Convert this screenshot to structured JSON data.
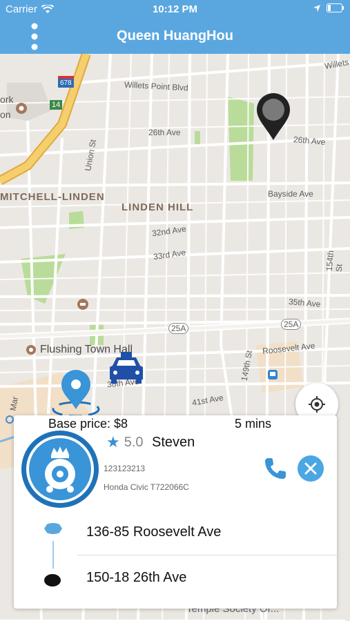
{
  "status": {
    "carrier": "Carrier",
    "time": "10:12 PM"
  },
  "nav": {
    "title": "Queen HuangHou"
  },
  "map": {
    "labels": {
      "willets_point": "Willets Point Blvd",
      "willets": "Willets",
      "ave26_left": "26th Ave",
      "ave26_right": "26th Ave",
      "union_st": "Union St",
      "mitchell_linden": "MITCHELL-LINDEN",
      "linden_hill": "LINDEN HILL",
      "bayside": "Bayside Ave",
      "ave32": "32nd Ave",
      "ave33": "33rd Ave",
      "st154": "154th St",
      "ave35": "35th Ave",
      "rt25a_left": "25A",
      "rt25a_right": "25A",
      "flushing_town_hall": "Flushing Town Hall",
      "roosevelt": "Roosevelt Ave",
      "st149": "149th St",
      "ave38": "38th Ave",
      "ave41": "41st Ave",
      "york_frag": "ork",
      "on_frag": "on",
      "i678": "678",
      "rt14": "14",
      "temple": "Temple Society Of...",
      "mar_frag": "Mar"
    }
  },
  "card": {
    "base_price": "Base price: $8",
    "eta": "5 mins",
    "rating": "5.0",
    "driver_name": "Steven",
    "phone": "123123213",
    "car": "Honda Civic T722066C",
    "pickup": "136-85 Roosevelt Ave",
    "dropoff": "150-18 26th Ave"
  },
  "colors": {
    "accent": "#5aa7e0",
    "park": "#b9dc9a",
    "highway": "#f2c25b"
  }
}
